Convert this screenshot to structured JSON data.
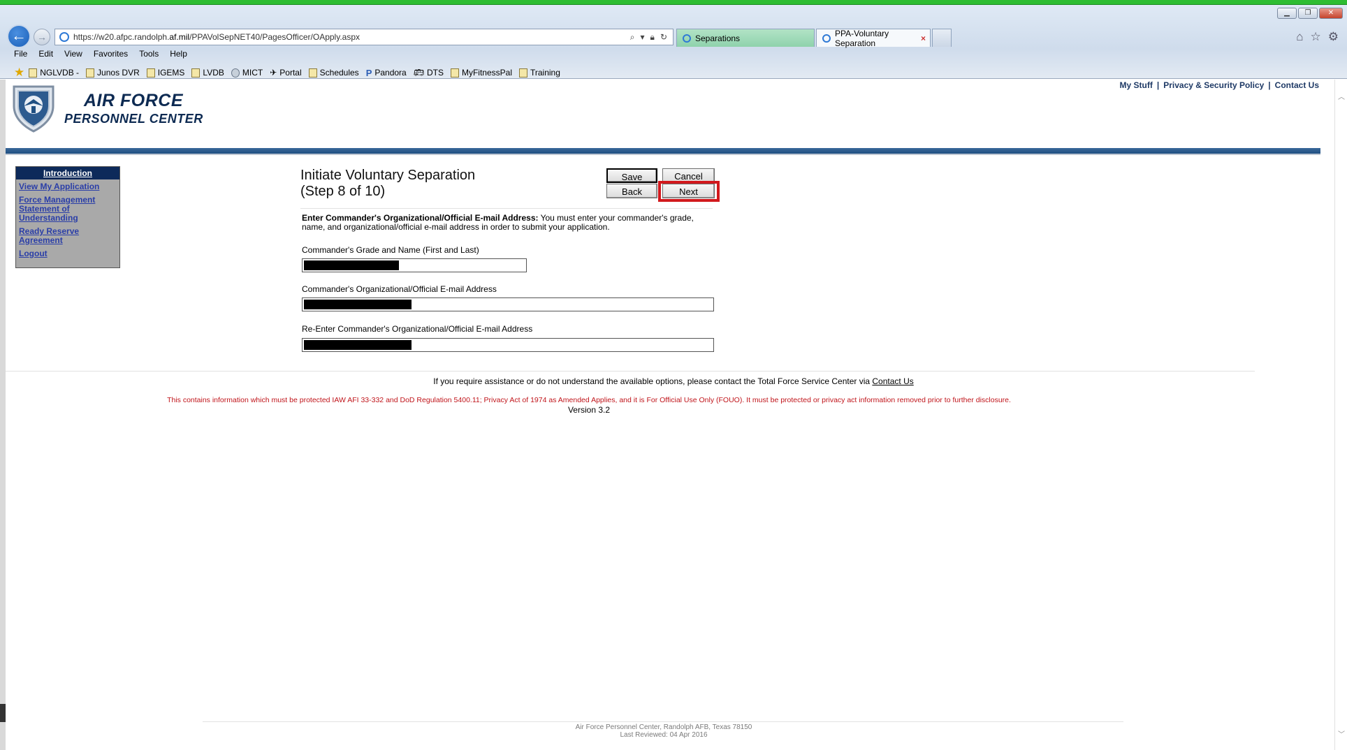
{
  "browser": {
    "url_prefix": "https://w20.afpc.randolph.",
    "url_domain": "af.mil",
    "url_path": "/PPAVolSepNET40/PagesOfficer/OApply.aspx",
    "tabs": [
      {
        "label": "Separations"
      },
      {
        "label": "PPA-Voluntary Separation",
        "close": "×"
      }
    ],
    "menu": [
      "File",
      "Edit",
      "View",
      "Favorites",
      "Tools",
      "Help"
    ],
    "favorites": [
      "NGLVDB -",
      "Junos DVR",
      "IGEMS",
      "LVDB",
      "MICT",
      "Portal",
      "Schedules",
      "Pandora",
      "DTS",
      "MyFitnessPal",
      "Training"
    ]
  },
  "header": {
    "title_line1": "AIR FORCE",
    "title_line2": "PERSONNEL CENTER",
    "links": [
      "My Stuff",
      "Privacy & Security Policy",
      "Contact Us"
    ],
    "link_separator": "|"
  },
  "sidebar": {
    "heading": "Introduction",
    "items": [
      {
        "label": "View My Application"
      },
      {
        "label": "Force Management Statement of Understanding"
      },
      {
        "label": "Ready Reserve Agreement"
      },
      {
        "label": "Logout"
      }
    ]
  },
  "form": {
    "title": "Initiate Voluntary Separation",
    "step": "(Step 8 of 10)",
    "buttons": {
      "save": "Save",
      "cancel": "Cancel",
      "back": "Back",
      "next": "Next"
    },
    "instructions_bold": "Enter Commander's Organizational/Official E-mail Address:",
    "instructions_text": " You must enter your commander's grade, name, and organizational/official e-mail address in order to submit your application.",
    "fields": {
      "name_label": "Commander's Grade and Name (First and Last)",
      "email_label": "Commander's Organizational/Official E-mail Address",
      "reemail_label": "Re-Enter Commander's Organizational/Official E-mail Address"
    }
  },
  "footer": {
    "assist_text": "If you require assistance or do not understand the available options, please contact the Total Force Service Center via ",
    "assist_link": "Contact Us",
    "privacy": "This contains information which must be protected IAW AFI 33-332 and DoD Regulation 5400.11; Privacy Act of 1974 as Amended Applies, and it is For Official Use Only (FOUO). It must be protected or privacy act information removed prior to further disclosure.",
    "version": "Version 3.2",
    "address": "Air Force Personnel Center, Randolph AFB, Texas 78150",
    "last_reviewed": "Last Reviewed: 04 Apr 2016"
  },
  "colors": {
    "highlight": "#d2191d",
    "banner": "#2ebd32",
    "nav_bar": "#1f4f82",
    "privacy_text": "#c0141a"
  }
}
